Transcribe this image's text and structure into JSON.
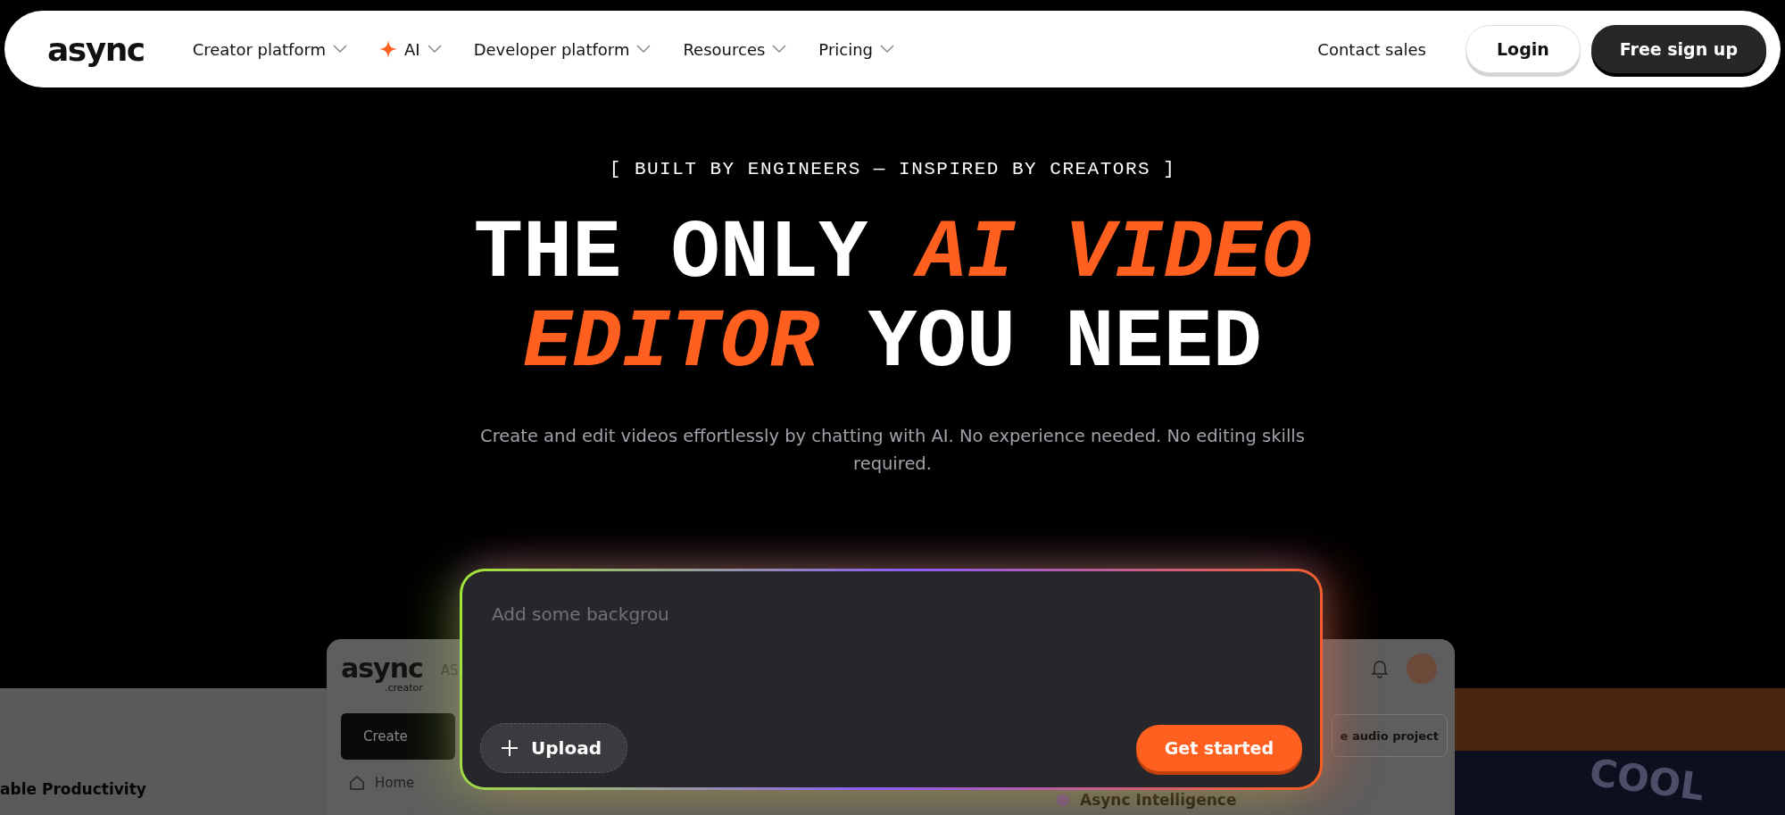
{
  "nav": {
    "logo": "async",
    "items": [
      {
        "label": "Creator platform",
        "sparkle": false
      },
      {
        "label": "AI",
        "sparkle": true
      },
      {
        "label": "Developer platform",
        "sparkle": false
      },
      {
        "label": "Resources",
        "sparkle": false
      },
      {
        "label": "Pricing",
        "sparkle": false
      }
    ],
    "contact": "Contact sales",
    "login": "Login",
    "signup": "Free sign up"
  },
  "hero": {
    "tagline": "[ BUILT BY ENGINEERS — INSPIRED BY CREATORS ]",
    "headline": [
      [
        {
          "text": "THE ONLY ",
          "highlight": false
        },
        {
          "text": "AI VIDEO",
          "highlight": true
        }
      ],
      [
        {
          "text": "EDITOR",
          "highlight": true
        },
        {
          "text": " YOU NEED",
          "highlight": false
        }
      ]
    ],
    "subtitle": "Create and edit videos effortlessly by chatting with AI. No experience needed. No editing skills required."
  },
  "prompt": {
    "placeholder": "Add some backgrou",
    "upload": "Upload",
    "submit": "Get started"
  },
  "preview": {
    "left_text": "able Productivity",
    "app_logo": "async",
    "app_logo_sub": ".creator",
    "app_initials": "AS",
    "create": "Create",
    "home": "Home",
    "audio_button": "e audio project",
    "intelligence": "Async Intelligence",
    "photo_text": "COOL"
  }
}
